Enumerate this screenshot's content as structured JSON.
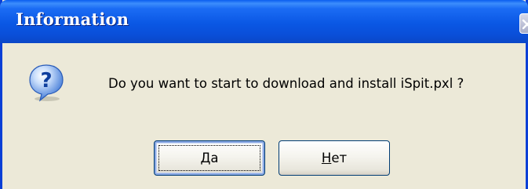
{
  "window": {
    "title": "Information",
    "title_color": "#ffffff",
    "titlebar_color": "#0a57e4",
    "face_color": "#ece9d8"
  },
  "dialog": {
    "icon": "question-icon",
    "icon_glyph": "?",
    "message": "Do you want to start to download and install iSpit.pxl ?"
  },
  "buttons": {
    "yes_mnemonic": "Д",
    "yes_rest": "а",
    "no_mnemonic": "Н",
    "no_rest": "ет"
  },
  "close_icon": "close-icon"
}
